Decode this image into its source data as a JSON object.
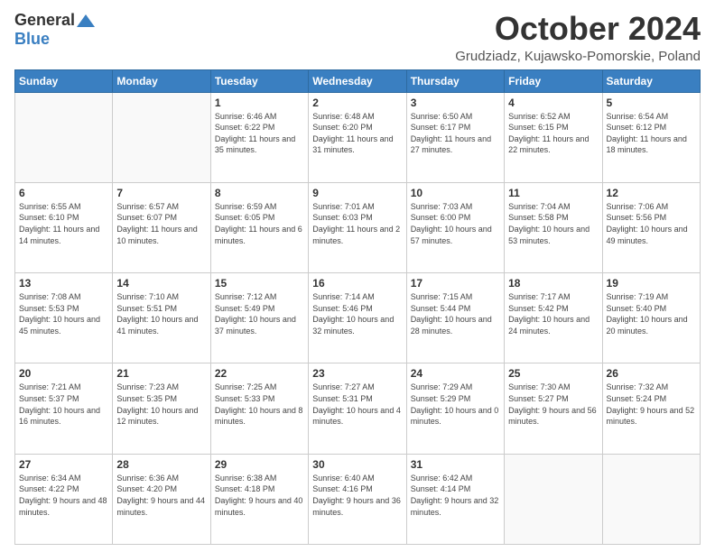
{
  "logo": {
    "general": "General",
    "blue": "Blue"
  },
  "header": {
    "title": "October 2024",
    "subtitle": "Grudziadz, Kujawsko-Pomorskie, Poland"
  },
  "days_of_week": [
    "Sunday",
    "Monday",
    "Tuesday",
    "Wednesday",
    "Thursday",
    "Friday",
    "Saturday"
  ],
  "weeks": [
    [
      {
        "day": "",
        "sunrise": "",
        "sunset": "",
        "daylight": ""
      },
      {
        "day": "",
        "sunrise": "",
        "sunset": "",
        "daylight": ""
      },
      {
        "day": "1",
        "sunrise": "Sunrise: 6:46 AM",
        "sunset": "Sunset: 6:22 PM",
        "daylight": "Daylight: 11 hours and 35 minutes."
      },
      {
        "day": "2",
        "sunrise": "Sunrise: 6:48 AM",
        "sunset": "Sunset: 6:20 PM",
        "daylight": "Daylight: 11 hours and 31 minutes."
      },
      {
        "day": "3",
        "sunrise": "Sunrise: 6:50 AM",
        "sunset": "Sunset: 6:17 PM",
        "daylight": "Daylight: 11 hours and 27 minutes."
      },
      {
        "day": "4",
        "sunrise": "Sunrise: 6:52 AM",
        "sunset": "Sunset: 6:15 PM",
        "daylight": "Daylight: 11 hours and 22 minutes."
      },
      {
        "day": "5",
        "sunrise": "Sunrise: 6:54 AM",
        "sunset": "Sunset: 6:12 PM",
        "daylight": "Daylight: 11 hours and 18 minutes."
      }
    ],
    [
      {
        "day": "6",
        "sunrise": "Sunrise: 6:55 AM",
        "sunset": "Sunset: 6:10 PM",
        "daylight": "Daylight: 11 hours and 14 minutes."
      },
      {
        "day": "7",
        "sunrise": "Sunrise: 6:57 AM",
        "sunset": "Sunset: 6:07 PM",
        "daylight": "Daylight: 11 hours and 10 minutes."
      },
      {
        "day": "8",
        "sunrise": "Sunrise: 6:59 AM",
        "sunset": "Sunset: 6:05 PM",
        "daylight": "Daylight: 11 hours and 6 minutes."
      },
      {
        "day": "9",
        "sunrise": "Sunrise: 7:01 AM",
        "sunset": "Sunset: 6:03 PM",
        "daylight": "Daylight: 11 hours and 2 minutes."
      },
      {
        "day": "10",
        "sunrise": "Sunrise: 7:03 AM",
        "sunset": "Sunset: 6:00 PM",
        "daylight": "Daylight: 10 hours and 57 minutes."
      },
      {
        "day": "11",
        "sunrise": "Sunrise: 7:04 AM",
        "sunset": "Sunset: 5:58 PM",
        "daylight": "Daylight: 10 hours and 53 minutes."
      },
      {
        "day": "12",
        "sunrise": "Sunrise: 7:06 AM",
        "sunset": "Sunset: 5:56 PM",
        "daylight": "Daylight: 10 hours and 49 minutes."
      }
    ],
    [
      {
        "day": "13",
        "sunrise": "Sunrise: 7:08 AM",
        "sunset": "Sunset: 5:53 PM",
        "daylight": "Daylight: 10 hours and 45 minutes."
      },
      {
        "day": "14",
        "sunrise": "Sunrise: 7:10 AM",
        "sunset": "Sunset: 5:51 PM",
        "daylight": "Daylight: 10 hours and 41 minutes."
      },
      {
        "day": "15",
        "sunrise": "Sunrise: 7:12 AM",
        "sunset": "Sunset: 5:49 PM",
        "daylight": "Daylight: 10 hours and 37 minutes."
      },
      {
        "day": "16",
        "sunrise": "Sunrise: 7:14 AM",
        "sunset": "Sunset: 5:46 PM",
        "daylight": "Daylight: 10 hours and 32 minutes."
      },
      {
        "day": "17",
        "sunrise": "Sunrise: 7:15 AM",
        "sunset": "Sunset: 5:44 PM",
        "daylight": "Daylight: 10 hours and 28 minutes."
      },
      {
        "day": "18",
        "sunrise": "Sunrise: 7:17 AM",
        "sunset": "Sunset: 5:42 PM",
        "daylight": "Daylight: 10 hours and 24 minutes."
      },
      {
        "day": "19",
        "sunrise": "Sunrise: 7:19 AM",
        "sunset": "Sunset: 5:40 PM",
        "daylight": "Daylight: 10 hours and 20 minutes."
      }
    ],
    [
      {
        "day": "20",
        "sunrise": "Sunrise: 7:21 AM",
        "sunset": "Sunset: 5:37 PM",
        "daylight": "Daylight: 10 hours and 16 minutes."
      },
      {
        "day": "21",
        "sunrise": "Sunrise: 7:23 AM",
        "sunset": "Sunset: 5:35 PM",
        "daylight": "Daylight: 10 hours and 12 minutes."
      },
      {
        "day": "22",
        "sunrise": "Sunrise: 7:25 AM",
        "sunset": "Sunset: 5:33 PM",
        "daylight": "Daylight: 10 hours and 8 minutes."
      },
      {
        "day": "23",
        "sunrise": "Sunrise: 7:27 AM",
        "sunset": "Sunset: 5:31 PM",
        "daylight": "Daylight: 10 hours and 4 minutes."
      },
      {
        "day": "24",
        "sunrise": "Sunrise: 7:29 AM",
        "sunset": "Sunset: 5:29 PM",
        "daylight": "Daylight: 10 hours and 0 minutes."
      },
      {
        "day": "25",
        "sunrise": "Sunrise: 7:30 AM",
        "sunset": "Sunset: 5:27 PM",
        "daylight": "Daylight: 9 hours and 56 minutes."
      },
      {
        "day": "26",
        "sunrise": "Sunrise: 7:32 AM",
        "sunset": "Sunset: 5:24 PM",
        "daylight": "Daylight: 9 hours and 52 minutes."
      }
    ],
    [
      {
        "day": "27",
        "sunrise": "Sunrise: 6:34 AM",
        "sunset": "Sunset: 4:22 PM",
        "daylight": "Daylight: 9 hours and 48 minutes."
      },
      {
        "day": "28",
        "sunrise": "Sunrise: 6:36 AM",
        "sunset": "Sunset: 4:20 PM",
        "daylight": "Daylight: 9 hours and 44 minutes."
      },
      {
        "day": "29",
        "sunrise": "Sunrise: 6:38 AM",
        "sunset": "Sunset: 4:18 PM",
        "daylight": "Daylight: 9 hours and 40 minutes."
      },
      {
        "day": "30",
        "sunrise": "Sunrise: 6:40 AM",
        "sunset": "Sunset: 4:16 PM",
        "daylight": "Daylight: 9 hours and 36 minutes."
      },
      {
        "day": "31",
        "sunrise": "Sunrise: 6:42 AM",
        "sunset": "Sunset: 4:14 PM",
        "daylight": "Daylight: 9 hours and 32 minutes."
      },
      {
        "day": "",
        "sunrise": "",
        "sunset": "",
        "daylight": ""
      },
      {
        "day": "",
        "sunrise": "",
        "sunset": "",
        "daylight": ""
      }
    ]
  ]
}
